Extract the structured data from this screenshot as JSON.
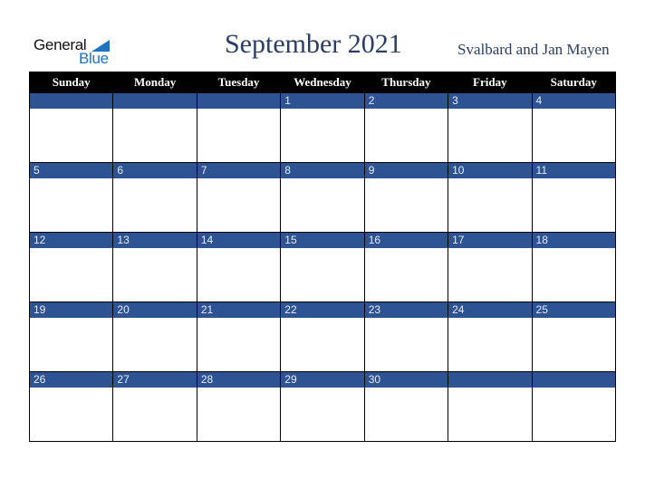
{
  "logo": {
    "line1": "General",
    "line2": "Blue"
  },
  "header": {
    "title": "September 2021",
    "region": "Svalbard and Jan Mayen"
  },
  "colors": {
    "header_bg": "#000000",
    "daybar_bg": "#2e5393",
    "title_color": "#2a3d66",
    "logo_blue": "#1f74c0"
  },
  "weekdays": [
    "Sunday",
    "Monday",
    "Tuesday",
    "Wednesday",
    "Thursday",
    "Friday",
    "Saturday"
  ],
  "weeks": [
    [
      "",
      "",
      "",
      "1",
      "2",
      "3",
      "4"
    ],
    [
      "5",
      "6",
      "7",
      "8",
      "9",
      "10",
      "11"
    ],
    [
      "12",
      "13",
      "14",
      "15",
      "16",
      "17",
      "18"
    ],
    [
      "19",
      "20",
      "21",
      "22",
      "23",
      "24",
      "25"
    ],
    [
      "26",
      "27",
      "28",
      "29",
      "30",
      "",
      ""
    ]
  ]
}
